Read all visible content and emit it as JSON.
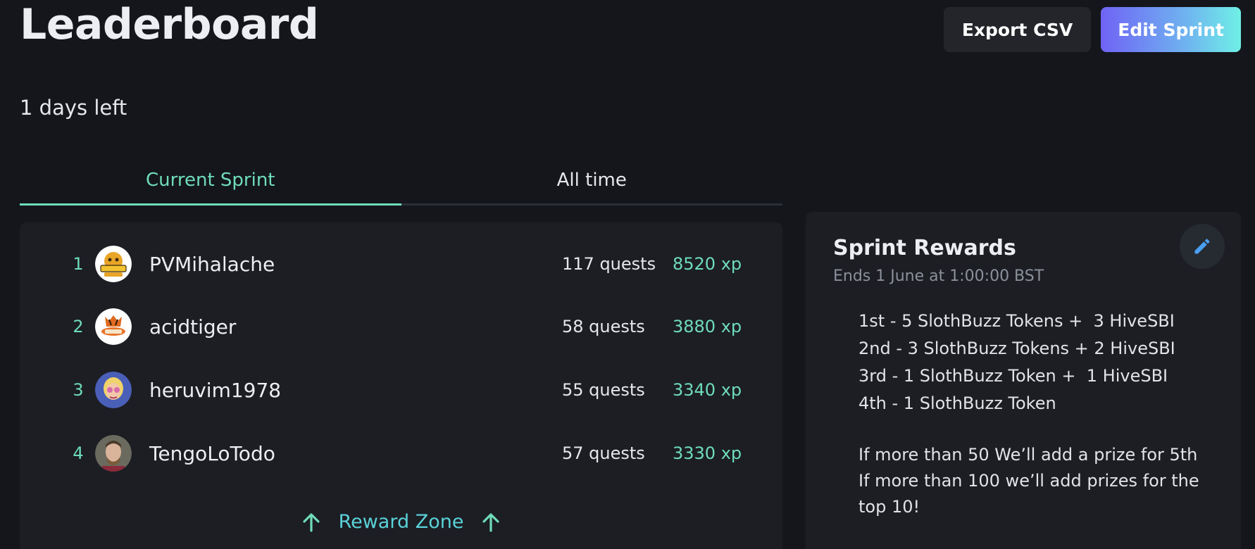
{
  "header": {
    "title": "Leaderboard",
    "export_label": "Export CSV",
    "edit_label": "Edit Sprint"
  },
  "countdown": "1 days left",
  "tabs": [
    {
      "label": "Current Sprint",
      "active": true
    },
    {
      "label": "All time",
      "active": false
    }
  ],
  "leaderboard": [
    {
      "rank": "1",
      "username": "PVMihalache",
      "quests": "117 quests",
      "xp": "8520 xp",
      "avatar": "humble-logo-avatar"
    },
    {
      "rank": "2",
      "username": "acidtiger",
      "quests": "58 quests",
      "xp": "3880 xp",
      "avatar": "tiger-logo-avatar"
    },
    {
      "rank": "3",
      "username": "heruvim1978",
      "quests": "55 quests",
      "xp": "3340 xp",
      "avatar": "cartoon-face-avatar"
    },
    {
      "rank": "4",
      "username": "TengoLoTodo",
      "quests": "57 quests",
      "xp": "3330 xp",
      "avatar": "photo-avatar"
    }
  ],
  "reward_zone_label": "Reward Zone",
  "rewards": {
    "title": "Sprint Rewards",
    "ends": "Ends 1 June at 1:00:00 BST",
    "items": [
      "1st - 5 SlothBuzz Tokens +  3 HiveSBI",
      "2nd - 3 SlothBuzz Tokens + 2 HiveSBI",
      "3rd - 1 SlothBuzz Token +  1 HiveSBI",
      "4th - 1 SlothBuzz Token"
    ],
    "notes": [
      "If more than 50 We’ll add a prize for 5th",
      "If more than 100 we’ll add prizes for the top 10!"
    ]
  },
  "colors": {
    "background": "#14161c",
    "panel": "#1c1e24",
    "accent_green": "#6fdcb8",
    "accent_cyan": "#5ad2d8"
  }
}
